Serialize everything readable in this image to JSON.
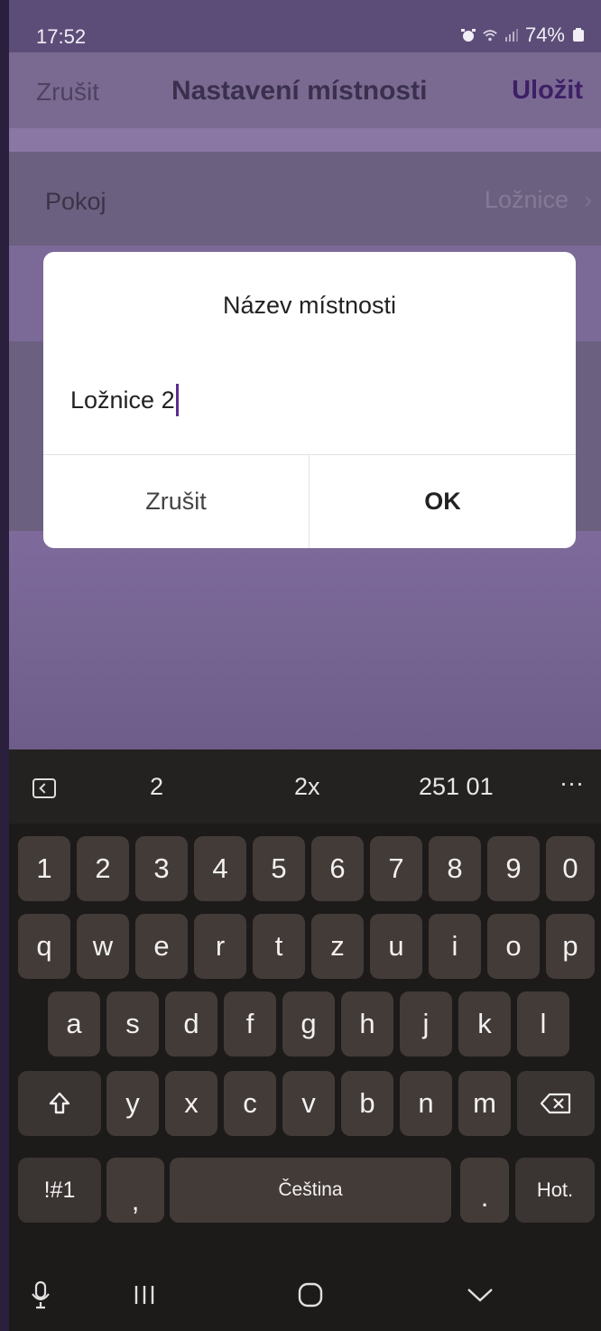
{
  "status_bar": {
    "time": "17:52",
    "battery": "74%"
  },
  "header": {
    "cancel": "Zrušit",
    "title": "Nastavení místnosti",
    "save": "Uložit"
  },
  "room_row": {
    "label": "Pokoj",
    "value": "Ložnice",
    "chevron": "›"
  },
  "dialog": {
    "title": "Název místnosti",
    "input_value": "Ložnice 2",
    "cancel": "Zrušit",
    "ok": "OK"
  },
  "keyboard": {
    "suggestions": [
      "2",
      "2x",
      "251 01",
      "···"
    ],
    "numbers": [
      "1",
      "2",
      "3",
      "4",
      "5",
      "6",
      "7",
      "8",
      "9",
      "0"
    ],
    "row1": [
      "q",
      "w",
      "e",
      "r",
      "t",
      "z",
      "u",
      "i",
      "o",
      "p"
    ],
    "row2": [
      "a",
      "s",
      "d",
      "f",
      "g",
      "h",
      "j",
      "k",
      "l"
    ],
    "row3": [
      "y",
      "x",
      "c",
      "v",
      "b",
      "n",
      "m"
    ],
    "symbols": "!#1",
    "comma": ",",
    "space": "Čeština",
    "period": ".",
    "enter": "Hot."
  }
}
